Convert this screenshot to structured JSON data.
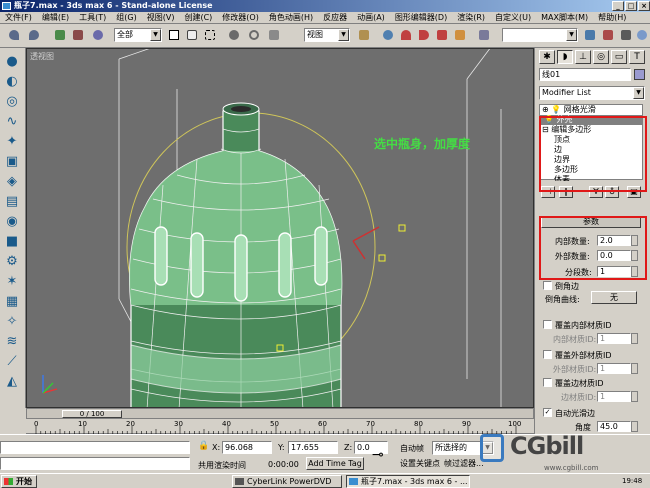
{
  "window": {
    "title": "瓶子7.max - 3ds max 6 - Stand-alone License"
  },
  "menu": [
    "文件(F)",
    "编辑(E)",
    "工具(T)",
    "组(G)",
    "视图(V)",
    "创建(C)",
    "修改器(O)",
    "角色动画(H)",
    "反应器",
    "动画(A)",
    "图形编辑器(D)",
    "渲染(R)",
    "自定义(U)",
    "MAX脚本(M)",
    "帮助(H)"
  ],
  "toolbar": {
    "selection_filter": "全部",
    "ref_coord": "视图"
  },
  "viewport": {
    "label": "透视图",
    "annotation": "选中瓶身，加厚度"
  },
  "timeline": {
    "slider_label": "0 / 100",
    "ticks": [
      "0",
      "10",
      "20",
      "30",
      "40",
      "50",
      "60",
      "70",
      "80",
      "90",
      "100"
    ]
  },
  "panel": {
    "object_name": "线01",
    "modifier_list": "Modifier List",
    "stack": {
      "mesh_smooth": "网格光滑",
      "shell": "外壳",
      "edit_poly": "编辑多边形",
      "sub": [
        "顶点",
        "边",
        "边界",
        "多边形",
        "体素"
      ]
    },
    "params": {
      "title": "参数",
      "inner_label": "内部数量:",
      "inner_value": "2.0",
      "outer_label": "外部数量:",
      "outer_value": "0.0",
      "seg_label": "分段数:",
      "seg_value": "1"
    },
    "bevel_edges": "倒角边",
    "bevel_curve": "倒角曲线:",
    "bevel_btn": "无",
    "override_inner": "覆盖内部材质ID",
    "inner_mat_id": "内部材质ID:",
    "inner_mat_val": "1",
    "override_outer": "覆盖外部材质ID",
    "outer_mat_id": "外部材质ID:",
    "outer_mat_val": "1",
    "override_edge": "覆盖边材质ID",
    "edge_mat_id": "边材质ID:",
    "edge_mat_val": "1",
    "auto_smooth": "自动光滑边",
    "angle_label": "角度",
    "angle_value": "45.0"
  },
  "status": {
    "x_label": "X:",
    "x_value": "96.068",
    "y_label": "Y:",
    "y_value": "17.655",
    "z_label": "Z:",
    "z_value": "0.0",
    "render_label": "共用渲染时间",
    "render_time": "0:00:00",
    "add_time_tag": "Add Time Tag",
    "autokey": "自动帧",
    "setkey": "设置关键点",
    "selected": "所选择的",
    "key_filter": "帧过滤器..."
  },
  "taskbar": {
    "start": "开始",
    "tasks": [
      "CyberLink PowerDVD",
      "瓶子7.max - 3ds max 6 - ..."
    ],
    "clock": "19:48"
  },
  "watermark": {
    "brand": "CGbill",
    "site": "www.cgbill.com"
  }
}
